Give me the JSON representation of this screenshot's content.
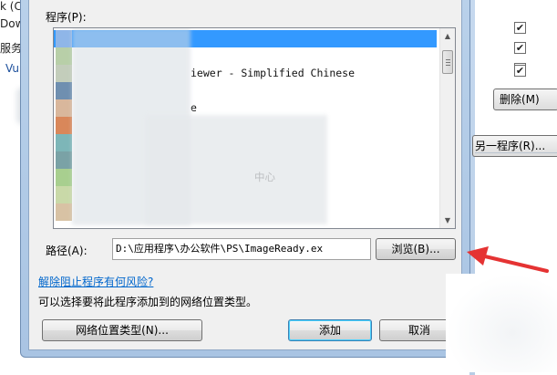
{
  "background_left": {
    "lines": [
      "k (C",
      "Dow",
      "服务",
      "Vul"
    ]
  },
  "background_right": {
    "checkboxes": [
      "checked",
      "checked",
      "unchecked",
      "checked"
    ],
    "check_glyph": "✔",
    "delete_button": "删除(M)",
    "other_program_button": "另一程序(R)..."
  },
  "dialog": {
    "program_label": "程序(P):",
    "program_list": {
      "items": [
        {
          "text": "",
          "selected": true,
          "icon_color": "#8fb6e8"
        },
        {
          "text": "",
          "selected": false,
          "icon_color": "#b8cfa8"
        },
        {
          "text": "iewer - Simplified Chinese",
          "selected": false,
          "icon_color": "#c3cdbb"
        },
        {
          "text": "",
          "selected": false,
          "icon_color": "#6f8fb0"
        },
        {
          "text": "e",
          "selected": false,
          "icon_color": "#d9b79c"
        },
        {
          "text": "",
          "selected": false,
          "icon_color": "#d9875a"
        },
        {
          "text": "",
          "selected": false,
          "icon_color": "#7db6b8"
        },
        {
          "text": "",
          "selected": false,
          "icon_color": "#7aa2a6"
        },
        {
          "text": "中心",
          "selected": false,
          "icon_color": "#a8cf8f"
        },
        {
          "text": "",
          "selected": false,
          "icon_color": "#c9d9a8"
        },
        {
          "text": "",
          "selected": false,
          "icon_color": "#d8c2a4"
        }
      ]
    },
    "path_label": "路径(A):",
    "path_value": "D:\\应用程序\\办公软件\\PS\\ImageReady.ex",
    "browse_button": "浏览(B)...",
    "risk_link": "解除阻止程序有何风险?",
    "network_hint": "可以选择要将此程序添加到的网络位置类型。",
    "network_type_button": "网络位置类型(N)...",
    "add_button": "添加",
    "cancel_button": "取消"
  },
  "colors": {
    "selection": "#3399ff",
    "link": "#0066cc",
    "annotation_arrow": "#e53333"
  }
}
